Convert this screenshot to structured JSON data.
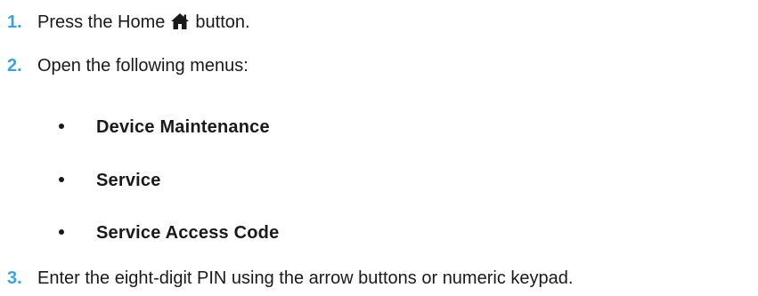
{
  "steps": [
    {
      "number": "1.",
      "text_before_icon": "Press the Home",
      "icon": "home-icon",
      "text_after_icon": "button."
    },
    {
      "number": "2.",
      "text": "Open the following menus:"
    },
    {
      "number": "3.",
      "text": "Enter the eight-digit PIN using the arrow buttons or numeric keypad."
    }
  ],
  "menus": [
    "Device Maintenance",
    "Service",
    "Service Access Code"
  ],
  "colors": {
    "step_number": "#3aa3de",
    "text": "#1a1a1a"
  }
}
